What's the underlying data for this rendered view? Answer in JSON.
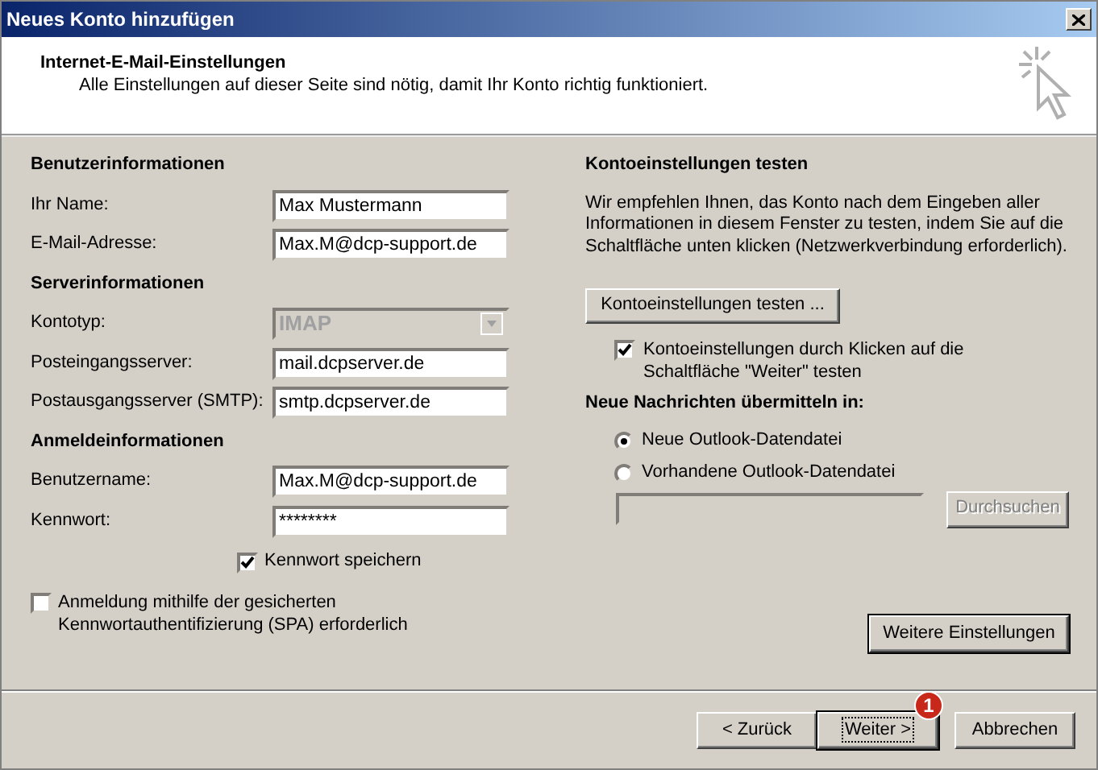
{
  "window": {
    "title": "Neues Konto hinzufügen"
  },
  "header": {
    "title": "Internet-E-Mail-Einstellungen",
    "subtitle": "Alle Einstellungen auf dieser Seite sind nötig, damit Ihr Konto richtig funktioniert."
  },
  "left": [
    {
      "kind": "heading",
      "text": "Benutzerinformationen"
    },
    {
      "kind": "text",
      "label": "Ihr Name:",
      "value": "Max Mustermann"
    },
    {
      "kind": "text",
      "label": "E-Mail-Adresse:",
      "value": "Max.M@dcp-support.de"
    },
    {
      "kind": "heading",
      "text": "Serverinformationen"
    },
    {
      "kind": "select",
      "label": "Kontotyp:",
      "value": "IMAP",
      "disabled": true
    },
    {
      "kind": "text",
      "label": "Posteingangsserver:",
      "value": "mail.dcpserver.de"
    },
    {
      "kind": "text",
      "label": "Postausgangsserver (SMTP):",
      "value": "smtp.dcpserver.de"
    },
    {
      "kind": "heading",
      "text": "Anmeldeinformationen"
    },
    {
      "kind": "text",
      "label": "Benutzername:",
      "value": "Max.M@dcp-support.de"
    },
    {
      "kind": "password",
      "label": "Kennwort:",
      "value": "********"
    },
    {
      "kind": "checkbox",
      "label": "Kennwort speichern",
      "checked": true,
      "indent": true
    },
    {
      "kind": "checkbox",
      "label": "Anmeldung mithilfe der gesicherten Kennwortauthentifizierung (SPA) erforderlich",
      "checked": false,
      "indent": false
    }
  ],
  "right": [
    {
      "kind": "heading",
      "text": "Kontoeinstellungen testen"
    },
    {
      "kind": "paragraph",
      "text": "Wir empfehlen Ihnen, das Konto nach dem Eingeben aller Informationen in diesem Fenster zu testen, indem Sie auf die Schaltfläche unten klicken (Netzwerkverbindung erforderlich)."
    },
    {
      "kind": "button",
      "label": "Kontoeinstellungen testen ..."
    },
    {
      "kind": "checkbox",
      "label": "Kontoeinstellungen durch Klicken auf die Schaltfläche \"Weiter\" testen",
      "checked": true
    },
    {
      "kind": "heading",
      "text": "Neue Nachrichten übermitteln in:"
    },
    {
      "kind": "radio",
      "label": "Neue Outlook-Datendatei",
      "selected": true
    },
    {
      "kind": "radio",
      "label": "Vorhandene Outlook-Datendatei",
      "selected": false
    },
    {
      "kind": "browse",
      "button": "Durchsuchen",
      "disabled": true
    },
    {
      "kind": "more",
      "label": "Weitere Einstellungen"
    }
  ],
  "footer": {
    "buttons": [
      {
        "label": "< Zurück",
        "default": false
      },
      {
        "label": "Weiter >",
        "default": true,
        "badge": "1"
      },
      {
        "label": "Abbrechen",
        "default": false
      }
    ]
  }
}
